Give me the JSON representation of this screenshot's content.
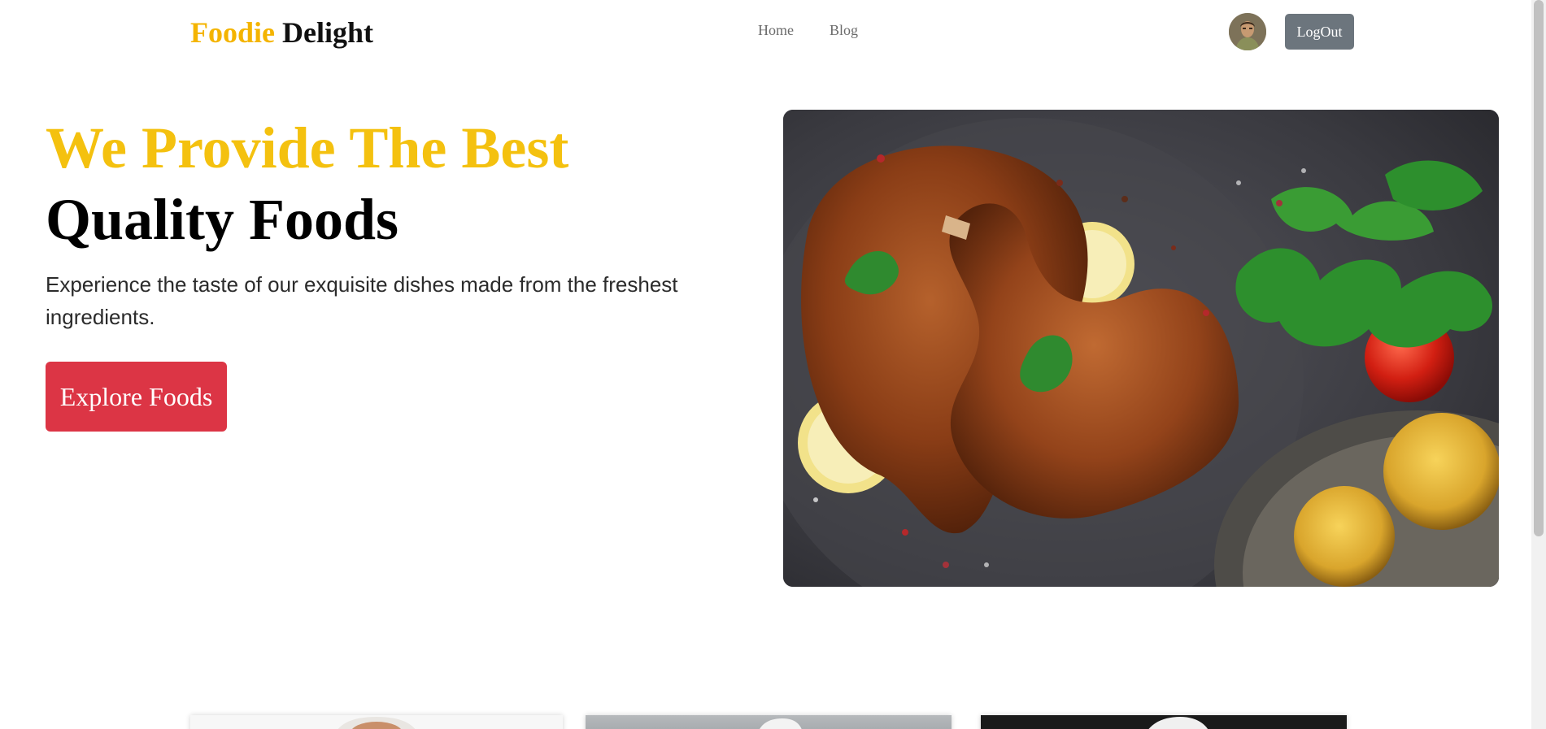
{
  "nav": {
    "brand_accent": "Foodie",
    "brand_main": "Delight",
    "links": [
      {
        "label": "Home"
      },
      {
        "label": "Blog"
      }
    ],
    "avatar_icon": "user-avatar",
    "logout_label": "LogOut"
  },
  "hero": {
    "title_line1": "We Provide The Best",
    "title_line2": "Quality Foods",
    "subtitle": "Experience the taste of our exquisite dishes made from the freshest ingredients.",
    "cta_label": "Explore Foods",
    "image_icon": "roasted-chicken-image"
  },
  "colors": {
    "brand_accent": "#f4b400",
    "hero_accent": "#f4c10f",
    "cta": "#dc3545",
    "logout": "#6c757d"
  }
}
